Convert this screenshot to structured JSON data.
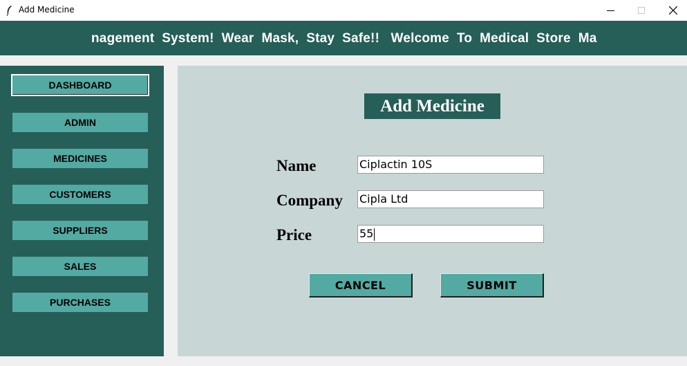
{
  "window": {
    "title": "Add Medicine",
    "icon": "feather-icon"
  },
  "banner": {
    "marquee_text": "nagement  System!  Wear  Mask,  Stay  Safe!!   Welcome  To  Medical  Store  Ma"
  },
  "sidebar": {
    "items": [
      {
        "label": "DASHBOARD",
        "active": true
      },
      {
        "label": "ADMIN"
      },
      {
        "label": "MEDICINES"
      },
      {
        "label": "CUSTOMERS"
      },
      {
        "label": "SUPPLIERS"
      },
      {
        "label": "SALES"
      },
      {
        "label": "PURCHASES"
      }
    ]
  },
  "form": {
    "title": "Add Medicine",
    "fields": [
      {
        "label": "Name",
        "value": "Ciplactin 10S"
      },
      {
        "label": "Company",
        "value": "Cipla Ltd"
      },
      {
        "label": "Price",
        "value": "55"
      }
    ],
    "cancel_label": "CANCEL",
    "submit_label": "SUBMIT"
  },
  "colors": {
    "primary": "#265e58",
    "button": "#52aaa2",
    "panel": "#c8d6d6",
    "background": "#f0f0f0"
  }
}
